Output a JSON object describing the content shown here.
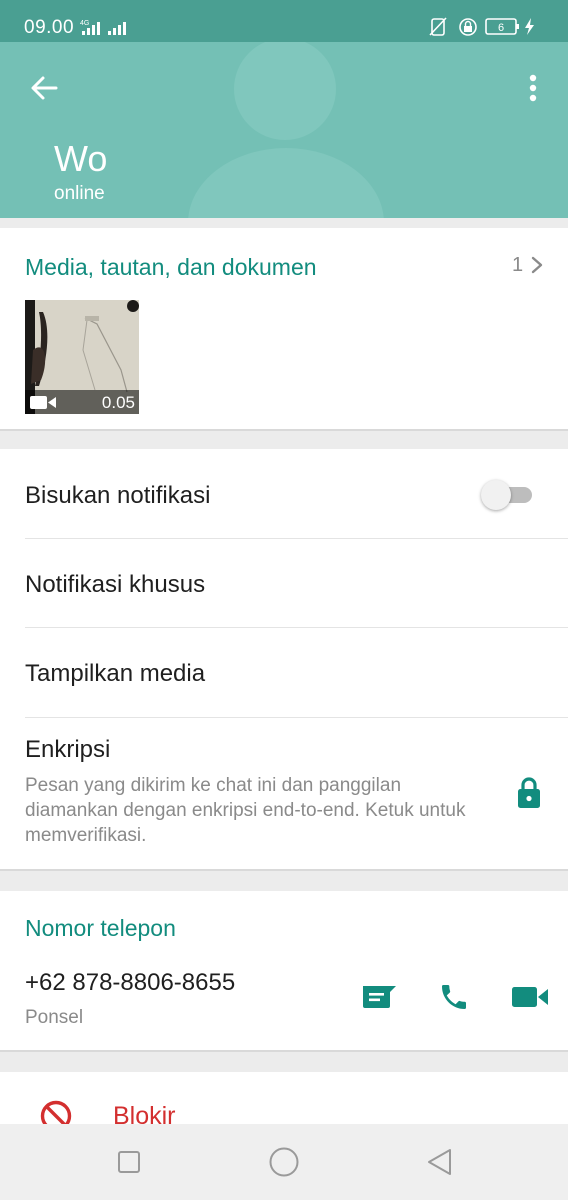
{
  "status_bar": {
    "time": "09.00",
    "network": "4G",
    "battery_level": "6"
  },
  "header": {
    "contact_name": "Wo",
    "contact_status": "online",
    "color": "#74c0b5"
  },
  "media": {
    "title": "Media, tautan, dan dokumen",
    "count": "1",
    "items": [
      {
        "type": "video",
        "duration": "0.05"
      }
    ]
  },
  "settings": {
    "mute_label": "Bisukan notifikasi",
    "mute_enabled": false,
    "custom_notifications_label": "Notifikasi khusus",
    "media_visibility_label": "Tampilkan media",
    "encryption_label": "Enkripsi",
    "encryption_description": "Pesan yang dikirim ke chat ini dan panggilan diamankan dengan enkripsi end-to-end. Ketuk untuk memverifikasi."
  },
  "phone": {
    "title": "Nomor telepon",
    "number": "+62 878-8806-8655",
    "type": "Ponsel"
  },
  "block": {
    "label": "Blokir"
  },
  "icons": {
    "back": "arrow-left-icon",
    "menu": "more-vertical-icon",
    "chevron": "chevron-right-icon",
    "video": "video-camera-icon",
    "lock": "lock-icon",
    "message": "message-icon",
    "call": "phone-icon",
    "video_call": "video-call-icon",
    "block": "block-icon"
  },
  "colors": {
    "accent": "#128c7e",
    "danger": "#d32f2f"
  }
}
